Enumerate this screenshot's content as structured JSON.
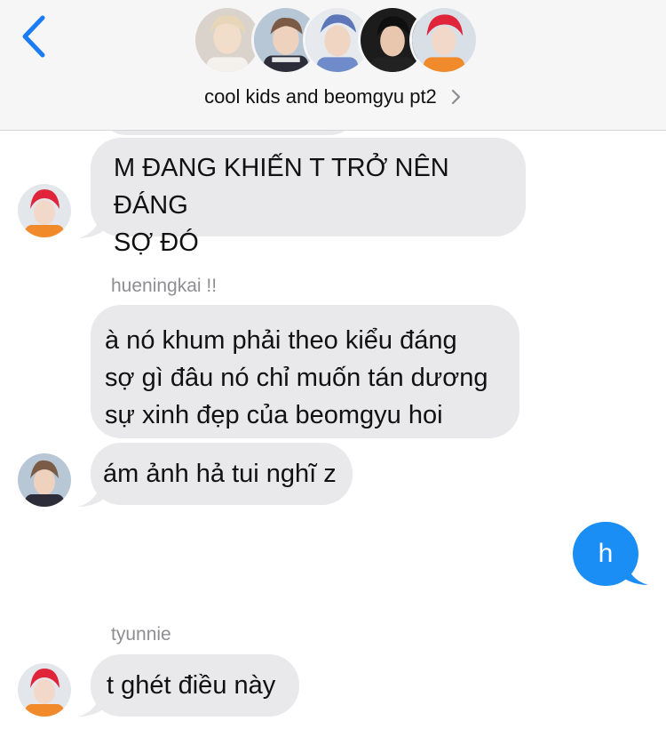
{
  "header": {
    "group_name": "cool kids and beomgyu pt2",
    "back_icon": "chevron-left-icon",
    "accent_color": "#1b7cf5",
    "avatars": [
      "member-1",
      "member-2",
      "member-3",
      "member-4",
      "member-5"
    ]
  },
  "messages": [
    {
      "sender": "",
      "text": "M ĐANG KHIẾN T TRỞ NÊN ĐÁNG\nSỢ ĐÓ",
      "direction": "incoming"
    },
    {
      "sender": "hueningkai !!",
      "text": "à nó khum phải theo kiểu đáng\nsợ gì đâu nó chỉ muốn tán dương\nsự xinh đẹp của beomgyu hoi",
      "direction": "incoming"
    },
    {
      "sender": "",
      "text": "ám ảnh hả tui nghĩ z",
      "direction": "incoming"
    },
    {
      "sender": "",
      "text": "h",
      "direction": "outgoing"
    },
    {
      "sender": "tyunnie",
      "text": "t ghét điều này",
      "direction": "incoming"
    }
  ],
  "colors": {
    "incoming_bubble": "#e9e9eb",
    "outgoing_bubble": "#1b8ef5",
    "header_bg": "#f6f6f6"
  }
}
